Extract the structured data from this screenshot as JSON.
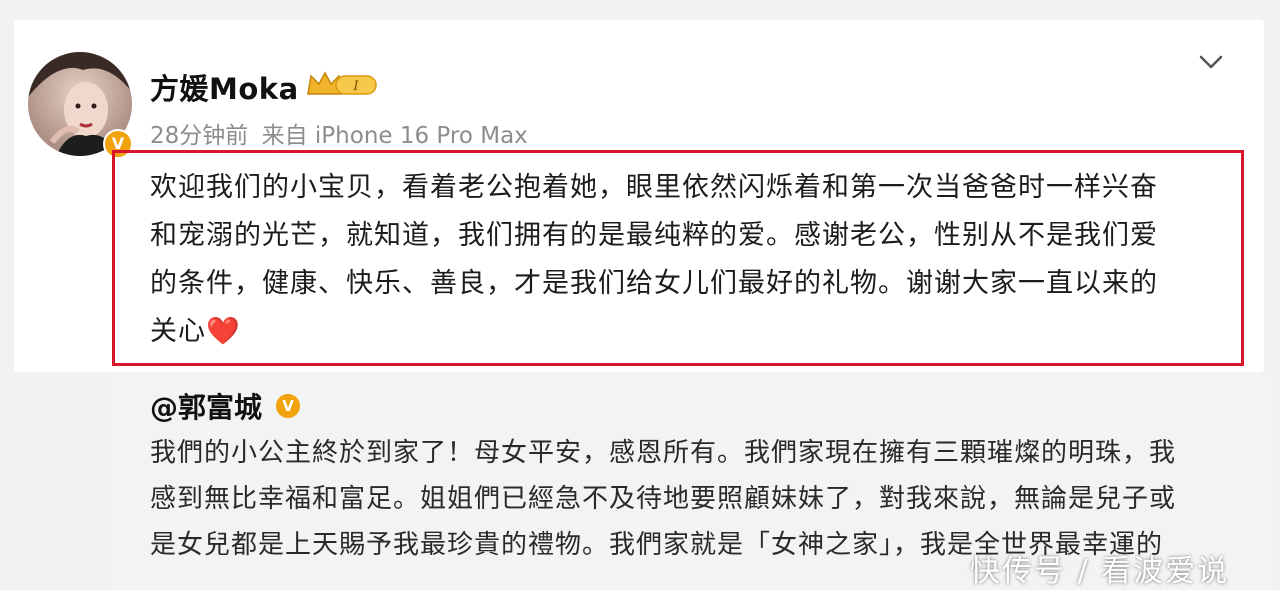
{
  "post": {
    "author": "方媛Moka",
    "level_badge": "I",
    "time": "28分钟前",
    "source": "来自 iPhone 16 Pro Max",
    "text_lines": [
      "欢迎我们的小宝贝，看着老公抱着她，眼里依然闪烁着和第一次当爸爸时一样兴奋",
      "和宠溺的光芒，就知道，我们拥有的是最纯粹的爱。感谢老公，性别从不是我们爱",
      "的条件，健康、快乐、善良，才是我们给女儿们最好的礼物。谢谢大家一直以来的",
      "关心"
    ],
    "heart_emoji": "❤️"
  },
  "repost": {
    "mention": "@郭富城",
    "text_lines": [
      "我們的小公主終於到家了！母女平安，感恩所有。我們家現在擁有三顆璀燦的明珠，我",
      "感到無比幸福和富足。姐姐們已經急不及待地要照顧妹妹了，對我來說，無論是兒子或",
      "是女兒都是上天賜予我最珍貴的禮物。我們家就是「女神之家」，我是全世界最幸運的"
    ]
  },
  "watermark": "快传号 / 看波爱说",
  "colors": {
    "highlight_border": "#d9152c",
    "verified_badge": "#f2a20c",
    "meta_text": "#8d8d8d"
  },
  "icons": {
    "verified": "verified-v-icon",
    "crown": "crown-level-icon",
    "menu": "chevron-down-icon"
  }
}
